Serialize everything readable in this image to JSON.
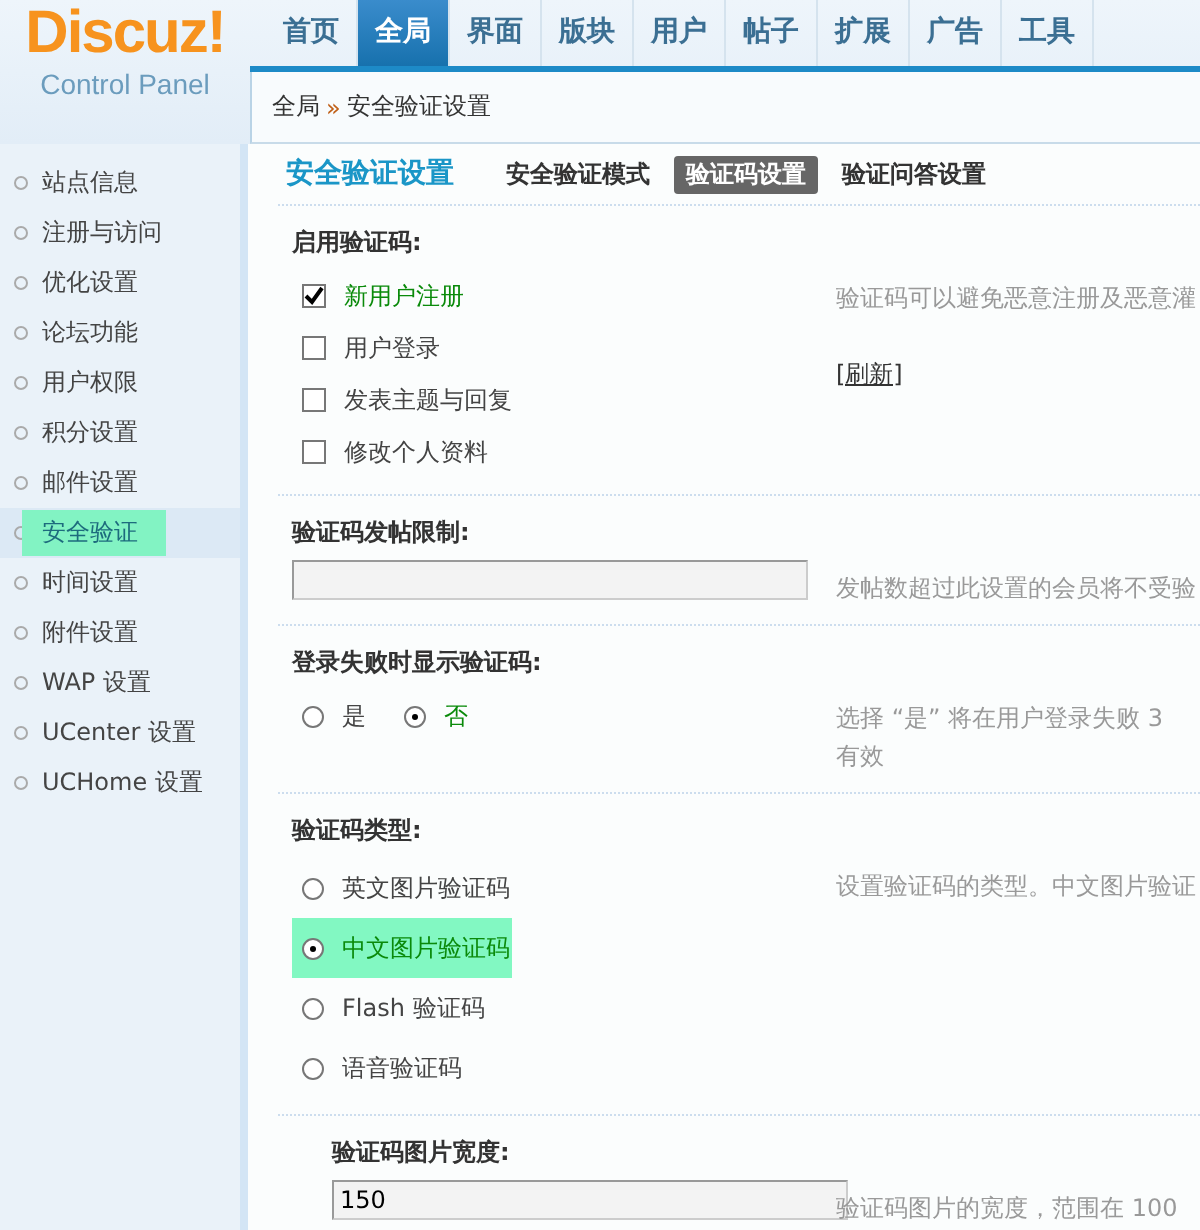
{
  "logo": {
    "name": "Discuz!",
    "subtitle": "Control Panel"
  },
  "nav": [
    {
      "label": "首页",
      "selected": false
    },
    {
      "label": "全局",
      "selected": true
    },
    {
      "label": "界面",
      "selected": false
    },
    {
      "label": "版块",
      "selected": false
    },
    {
      "label": "用户",
      "selected": false
    },
    {
      "label": "帖子",
      "selected": false
    },
    {
      "label": "扩展",
      "selected": false
    },
    {
      "label": "广告",
      "selected": false
    },
    {
      "label": "工具",
      "selected": false
    }
  ],
  "breadcrumb": {
    "items": [
      "全局",
      "安全验证设置"
    ],
    "separator": "»"
  },
  "sidebar": [
    {
      "label": "站点信息",
      "selected": false
    },
    {
      "label": "注册与访问",
      "selected": false
    },
    {
      "label": "优化设置",
      "selected": false
    },
    {
      "label": "论坛功能",
      "selected": false
    },
    {
      "label": "用户权限",
      "selected": false
    },
    {
      "label": "积分设置",
      "selected": false
    },
    {
      "label": "邮件设置",
      "selected": false
    },
    {
      "label": "安全验证",
      "selected": true
    },
    {
      "label": "时间设置",
      "selected": false
    },
    {
      "label": "附件设置",
      "selected": false
    },
    {
      "label": "WAP 设置",
      "selected": false
    },
    {
      "label": "UCenter 设置",
      "selected": false
    },
    {
      "label": "UCHome 设置",
      "selected": false
    }
  ],
  "page_title": "安全验证设置",
  "tabs": [
    {
      "label": "安全验证模式",
      "selected": false
    },
    {
      "label": "验证码设置",
      "selected": true
    },
    {
      "label": "验证问答设置",
      "selected": false
    }
  ],
  "sections": [
    {
      "kind": "checkboxes",
      "label": "启用验证码:",
      "options": [
        {
          "label": "新用户注册",
          "checked": true
        },
        {
          "label": "用户登录",
          "checked": false
        },
        {
          "label": "发表主题与回复",
          "checked": false
        },
        {
          "label": "修改个人资料",
          "checked": false
        }
      ],
      "hint": [
        "验证码可以避免恶意注册及恶意灌"
      ],
      "link": "[刷新]"
    },
    {
      "kind": "text",
      "label": "验证码发帖限制:",
      "hint": [
        "发帖数超过此设置的会员将不受验"
      ]
    },
    {
      "kind": "radio_row",
      "label": "登录失败时显示验证码:",
      "options": [
        {
          "label": "是",
          "selected": false
        },
        {
          "label": "否",
          "selected": true
        }
      ],
      "hint": [
        "选择 “是” 将在用户登录失败 3",
        "有效"
      ]
    },
    {
      "kind": "radio_list",
      "label": "验证码类型:",
      "options": [
        {
          "label": "英文图片验证码",
          "selected": false
        },
        {
          "label": "中文图片验证码",
          "selected": true
        },
        {
          "label": "Flash 验证码",
          "selected": false
        },
        {
          "label": "语音验证码",
          "selected": false
        }
      ],
      "hint": [
        "设置验证码的类型。中文图片验证"
      ]
    },
    {
      "kind": "text",
      "label": "验证码图片宽度:",
      "value": "150",
      "indented": true,
      "hint": [
        "验证码图片的宽度，范围在 100"
      ]
    }
  ]
}
